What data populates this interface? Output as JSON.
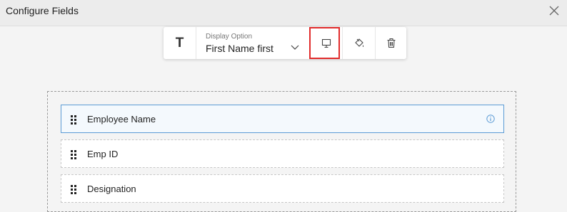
{
  "dialog": {
    "title": "Configure Fields"
  },
  "toolbar": {
    "text_icon": "T",
    "display_option_label": "Display Option",
    "display_option_value": "First Name first"
  },
  "fields": [
    {
      "label": "Employee Name",
      "selected": true
    },
    {
      "label": "Emp ID",
      "selected": false
    },
    {
      "label": "Designation",
      "selected": false
    }
  ],
  "colors": {
    "highlight": "#e12b2b",
    "selected_border": "#5b9bd5",
    "info_icon": "#5b9bd5"
  },
  "icons": [
    "close-icon",
    "text-field-icon",
    "chevron-down-icon",
    "monitor-icon",
    "paint-bucket-icon",
    "trash-icon",
    "drag-handle-icon",
    "info-icon"
  ]
}
